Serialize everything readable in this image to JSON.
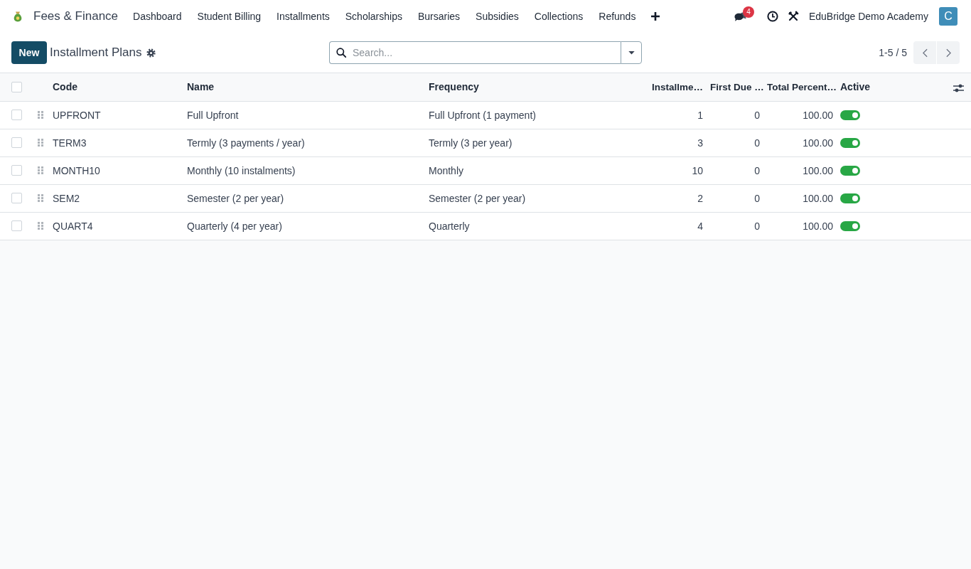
{
  "navbar": {
    "app_name": "Fees & Finance",
    "menu": [
      "Dashboard",
      "Student Billing",
      "Installments",
      "Scholarships",
      "Bursaries",
      "Subsidies",
      "Collections",
      "Refunds"
    ],
    "message_count": "4",
    "company": "EduBridge Demo Academy",
    "avatar_initial": "C"
  },
  "control_panel": {
    "new_button": "New",
    "title": "Installment Plans",
    "search": {
      "placeholder": "Search..."
    },
    "pager": "1-5 / 5"
  },
  "table": {
    "select_all": false,
    "columns": [
      "Code",
      "Name",
      "Frequency",
      "Installme…",
      "First Due …",
      "Total Percent…",
      "Active"
    ],
    "rows": [
      {
        "selected": false,
        "code": "UPFRONT",
        "name": "Full Upfront",
        "frequency": "Full Upfront (1 payment)",
        "installments": "1",
        "first_due": "0",
        "total_percent": "100.00",
        "active": true
      },
      {
        "selected": false,
        "code": "TERM3",
        "name": "Termly (3 payments / year)",
        "frequency": "Termly (3 per year)",
        "installments": "3",
        "first_due": "0",
        "total_percent": "100.00",
        "active": true
      },
      {
        "selected": false,
        "code": "MONTH10",
        "name": "Monthly (10 instalments)",
        "frequency": "Monthly",
        "installments": "10",
        "first_due": "0",
        "total_percent": "100.00",
        "active": true
      },
      {
        "selected": false,
        "code": "SEM2",
        "name": "Semester (2 per year)",
        "frequency": "Semester (2 per year)",
        "installments": "2",
        "first_due": "0",
        "total_percent": "100.00",
        "active": true
      },
      {
        "selected": false,
        "code": "QUART4",
        "name": "Quarterly (4 per year)",
        "frequency": "Quarterly",
        "installments": "4",
        "first_due": "0",
        "total_percent": "100.00",
        "active": true
      }
    ]
  }
}
